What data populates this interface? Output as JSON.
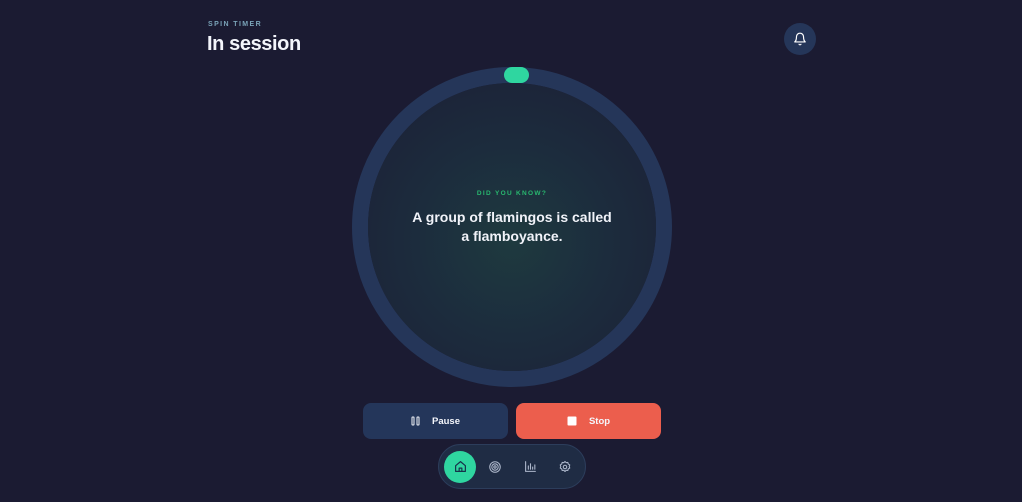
{
  "header": {
    "eyebrow": "SPIN TIMER",
    "title": "In session"
  },
  "timer": {
    "progress": 0.0,
    "fact_label": "DID YOU KNOW?",
    "fact_text": "A group of flamingos is called a flamboyance."
  },
  "controls": {
    "pause_label": "Pause",
    "stop_label": "Stop"
  },
  "nav": {
    "items": [
      {
        "name": "home",
        "icon": "home-icon",
        "active": true
      },
      {
        "name": "target",
        "icon": "target-icon",
        "active": false
      },
      {
        "name": "stats",
        "icon": "bar-chart-icon",
        "active": false
      },
      {
        "name": "settings",
        "icon": "gear-icon",
        "active": false
      }
    ]
  },
  "colors": {
    "background": "#1b1b32",
    "accent": "#2fd6a0",
    "ring_track": "#253659",
    "stop": "#ec5e4d",
    "fact_label": "#28b86f"
  }
}
